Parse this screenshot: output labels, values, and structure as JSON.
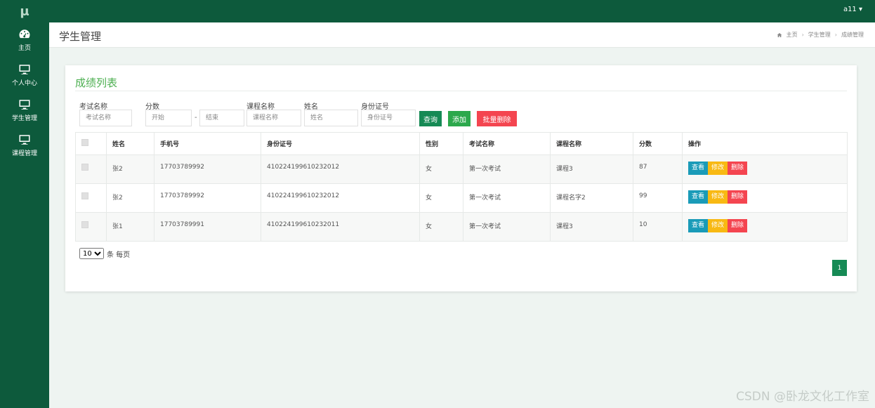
{
  "app": {
    "logo": "μ"
  },
  "sidebar": {
    "items": [
      {
        "label": "主页",
        "icon": "dashboard-icon"
      },
      {
        "label": "个人中心",
        "icon": "monitor-icon"
      },
      {
        "label": "学生管理",
        "icon": "monitor-icon"
      },
      {
        "label": "课程管理",
        "icon": "monitor-icon"
      }
    ]
  },
  "topbar": {
    "user": "a11 ▾"
  },
  "header": {
    "title": "学生管理",
    "breadcrumb": [
      "主页",
      "学生管理",
      "成绩管理"
    ]
  },
  "panel": {
    "title": "成绩列表",
    "filters": {
      "exam_label": "考试名称",
      "exam_placeholder": "考试名称",
      "score_label": "分数",
      "score_start_placeholder": "开始",
      "score_dash": "-",
      "score_end_placeholder": "结束",
      "course_label": "课程名称",
      "course_placeholder": "课程名称",
      "name_label": "姓名",
      "name_placeholder": "姓名",
      "id_label": "身份证号",
      "id_placeholder": "身份证号"
    },
    "buttons": {
      "query": "查询",
      "add": "添加",
      "batch_delete": "批量删除"
    }
  },
  "table": {
    "columns": [
      "姓名",
      "手机号",
      "身份证号",
      "性别",
      "考试名称",
      "课程名称",
      "分数",
      "操作"
    ],
    "rows": [
      {
        "name": "张2",
        "phone": "17703789992",
        "id_card": "410224199610232012",
        "gender": "女",
        "exam": "第一次考试",
        "course": "课程3",
        "score": "87"
      },
      {
        "name": "张2",
        "phone": "17703789992",
        "id_card": "410224199610232012",
        "gender": "女",
        "exam": "第一次考试",
        "course": "课程名字2",
        "score": "99"
      },
      {
        "name": "张1",
        "phone": "17703789991",
        "id_card": "410224199610232011",
        "gender": "女",
        "exam": "第一次考试",
        "course": "课程3",
        "score": "10"
      }
    ],
    "actions": {
      "view": "查看",
      "edit": "修改",
      "delete": "删除"
    }
  },
  "pagination": {
    "page_size": "10",
    "page_size_suffix": "条 每页",
    "current_page": "1"
  },
  "watermark": "CSDN @卧龙文化工作室",
  "colors": {
    "primary": "#0d5a3c",
    "accent_green": "#168a55",
    "danger": "#f44550",
    "warning": "#f8b913",
    "info": "#1a9bb8"
  }
}
